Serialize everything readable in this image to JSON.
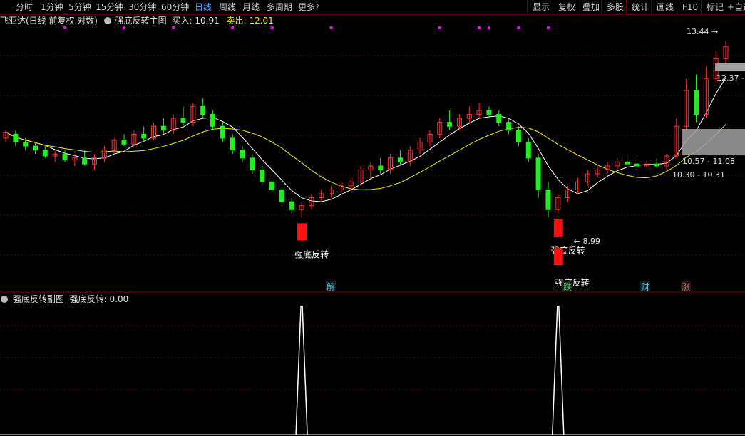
{
  "toolbar": {
    "periods": [
      "分时",
      "1分钟",
      "5分钟",
      "15分钟",
      "30分钟",
      "60分钟",
      "日线",
      "周线",
      "月线",
      "多周期",
      "更多"
    ],
    "active_period": "日线",
    "more_arrow": "〉",
    "right_buttons": [
      "显示",
      "复权",
      "叠加",
      "多股",
      "统计",
      "画线",
      "F10",
      "标记",
      "+自选"
    ]
  },
  "main_legend": {
    "stock": "飞亚达(日线 前复权.对数)",
    "indicator": "强底反转主图",
    "buy_label": "买入:",
    "buy_value": "10.91",
    "sell_label": "卖出:",
    "sell_value": "12.01"
  },
  "sub_legend": {
    "indicator": "强底反转副图",
    "value_label": "强底反转:",
    "value": "0.00"
  },
  "annotations": {
    "signal_text": "强底反转",
    "low_price": "8.99",
    "high_price": "13.44",
    "price_tag_1": "12.37 -",
    "range_1": "10.57 - 11.08",
    "range_2": "10.30 - 10.31"
  },
  "events": [
    {
      "label": "解",
      "color": "#4fc3f7"
    },
    {
      "label": "跌",
      "color": "#2ecc40"
    },
    {
      "label": "财",
      "color": "#4fc3f7"
    },
    {
      "label": "涨",
      "color": "#ff6060"
    }
  ],
  "colors": {
    "up": "#ff3030",
    "down": "#00e0e0",
    "green": "#22ee22",
    "ma_white": "#ffffff",
    "ma_yellow": "#f0f000",
    "grid": "#5a0000",
    "marker": "#ff00ff"
  },
  "chart_data": {
    "type": "candlestick",
    "candles": [
      [
        11.0,
        11.2,
        10.9,
        11.15
      ],
      [
        11.1,
        11.2,
        10.8,
        10.9
      ],
      [
        10.9,
        11.0,
        10.7,
        10.8
      ],
      [
        10.8,
        10.9,
        10.6,
        10.7
      ],
      [
        10.7,
        10.8,
        10.5,
        10.55
      ],
      [
        10.55,
        10.7,
        10.4,
        10.6
      ],
      [
        10.6,
        10.7,
        10.4,
        10.45
      ],
      [
        10.45,
        10.6,
        10.3,
        10.5
      ],
      [
        10.5,
        10.7,
        10.3,
        10.35
      ],
      [
        10.35,
        10.6,
        10.2,
        10.5
      ],
      [
        10.5,
        10.8,
        10.4,
        10.7
      ],
      [
        10.7,
        11.0,
        10.6,
        10.95
      ],
      [
        10.95,
        11.1,
        10.8,
        10.85
      ],
      [
        10.85,
        11.2,
        10.8,
        11.1
      ],
      [
        11.1,
        11.3,
        10.9,
        11.0
      ],
      [
        11.0,
        11.4,
        10.95,
        11.3
      ],
      [
        11.3,
        11.5,
        11.1,
        11.2
      ],
      [
        11.2,
        11.6,
        11.1,
        11.5
      ],
      [
        11.5,
        11.8,
        11.3,
        11.4
      ],
      [
        11.4,
        11.9,
        11.3,
        11.8
      ],
      [
        11.8,
        12.0,
        11.5,
        11.6
      ],
      [
        11.6,
        11.7,
        11.2,
        11.3
      ],
      [
        11.3,
        11.4,
        10.9,
        11.0
      ],
      [
        11.0,
        11.1,
        10.6,
        10.7
      ],
      [
        10.7,
        10.8,
        10.4,
        10.5
      ],
      [
        10.5,
        10.6,
        10.1,
        10.2
      ],
      [
        10.2,
        10.3,
        9.8,
        9.9
      ],
      [
        9.9,
        10.0,
        9.6,
        9.7
      ],
      [
        9.7,
        9.8,
        9.3,
        9.4
      ],
      [
        9.4,
        9.5,
        9.1,
        9.2
      ],
      [
        9.2,
        9.4,
        9.0,
        9.3
      ],
      [
        9.3,
        9.6,
        9.2,
        9.5
      ],
      [
        9.5,
        9.7,
        9.4,
        9.6
      ],
      [
        9.6,
        9.8,
        9.5,
        9.7
      ],
      [
        9.7,
        9.9,
        9.6,
        9.8
      ],
      [
        9.8,
        10.0,
        9.7,
        9.9
      ],
      [
        9.9,
        10.3,
        9.8,
        10.2
      ],
      [
        10.2,
        10.4,
        10.0,
        10.3
      ],
      [
        10.3,
        10.5,
        10.1,
        10.2
      ],
      [
        10.2,
        10.6,
        10.1,
        10.5
      ],
      [
        10.5,
        10.7,
        10.3,
        10.4
      ],
      [
        10.4,
        10.8,
        10.3,
        10.7
      ],
      [
        10.7,
        11.0,
        10.6,
        10.9
      ],
      [
        10.9,
        11.2,
        10.8,
        11.1
      ],
      [
        11.1,
        11.5,
        11.0,
        11.4
      ],
      [
        11.4,
        11.7,
        11.2,
        11.3
      ],
      [
        11.3,
        11.6,
        11.2,
        11.5
      ],
      [
        11.5,
        11.8,
        11.4,
        11.6
      ],
      [
        11.6,
        11.9,
        11.5,
        11.7
      ],
      [
        11.7,
        11.8,
        11.5,
        11.6
      ],
      [
        11.6,
        11.7,
        11.3,
        11.4
      ],
      [
        11.4,
        11.5,
        11.1,
        11.2
      ],
      [
        11.2,
        11.3,
        10.8,
        10.9
      ],
      [
        10.9,
        11.0,
        10.4,
        10.5
      ],
      [
        10.5,
        10.6,
        9.5,
        9.7
      ],
      [
        9.7,
        9.9,
        9.0,
        9.2
      ],
      [
        9.2,
        9.6,
        9.1,
        9.5
      ],
      [
        9.5,
        9.8,
        9.4,
        9.7
      ],
      [
        9.7,
        10.0,
        9.6,
        9.9
      ],
      [
        9.9,
        10.2,
        9.8,
        10.1
      ],
      [
        10.1,
        10.3,
        10.0,
        10.2
      ],
      [
        10.2,
        10.4,
        10.1,
        10.3
      ],
      [
        10.3,
        10.5,
        10.2,
        10.4
      ],
      [
        10.4,
        10.6,
        10.3,
        10.35
      ],
      [
        10.35,
        10.5,
        10.2,
        10.3
      ],
      [
        10.3,
        10.45,
        10.2,
        10.35
      ],
      [
        10.35,
        10.5,
        10.25,
        10.3
      ],
      [
        10.3,
        10.6,
        10.2,
        10.55
      ],
      [
        10.55,
        11.5,
        10.5,
        11.3
      ],
      [
        11.3,
        12.5,
        11.2,
        12.2
      ],
      [
        12.2,
        12.6,
        11.4,
        11.6
      ],
      [
        11.6,
        12.8,
        11.5,
        12.5
      ],
      [
        12.5,
        13.2,
        12.4,
        13.0
      ],
      [
        13.0,
        13.44,
        12.8,
        13.3
      ]
    ],
    "price_range": [
      8.9,
      13.6
    ],
    "signal_indices": [
      30,
      56
    ],
    "subchart": {
      "name": "强底反转",
      "peaks": [
        30,
        56
      ],
      "range": [
        0,
        1
      ]
    }
  }
}
